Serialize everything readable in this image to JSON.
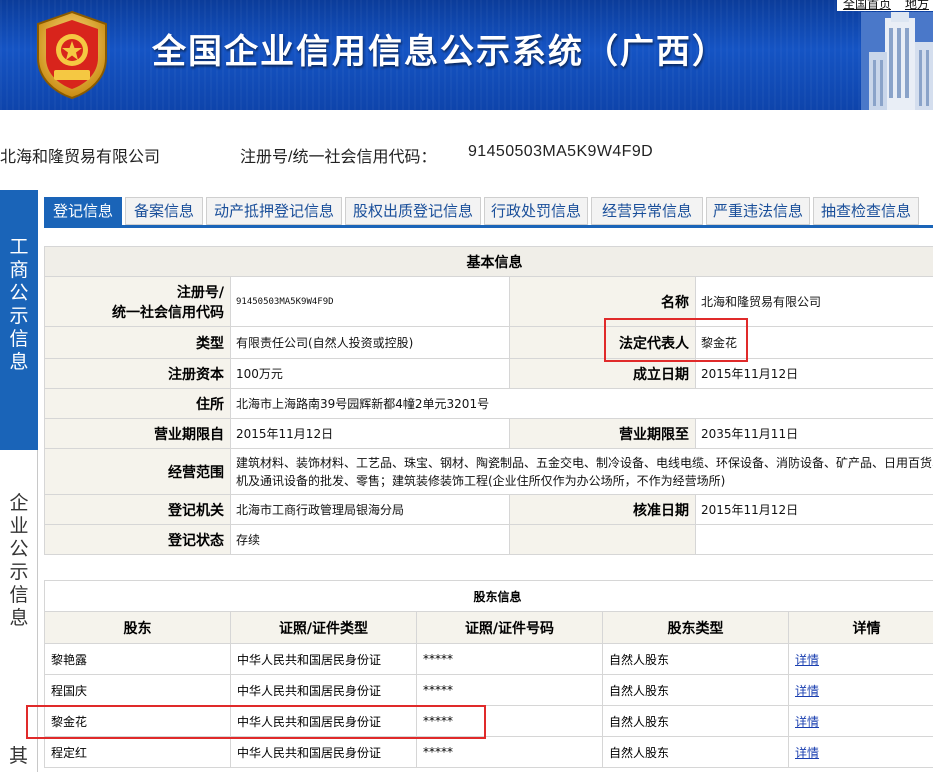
{
  "header": {
    "title": "全国企业信用信息公示系统（广西）",
    "links": [
      "全国首页",
      "地方"
    ]
  },
  "company": {
    "name": "北海和隆贸易有限公司",
    "regcode_label": "注册号/统一社会信用代码：",
    "regcode_value": "91450503MA5K9W4F9D"
  },
  "side_nav": {
    "section1": "工商公示信息",
    "section2": "企业公示信息",
    "section3": "其"
  },
  "tabs": [
    "登记信息",
    "备案信息",
    "动产抵押登记信息",
    "股权出质登记信息",
    "行政处罚信息",
    "经营异常信息",
    "严重违法信息",
    "抽查检查信息"
  ],
  "basic_info": {
    "heading": "基本信息",
    "reg_no_label_line1": "注册号/",
    "reg_no_label_line2": "统一社会信用代码",
    "reg_no": "91450503MA5K9W4F9D",
    "name_label": "名称",
    "name": "北海和隆贸易有限公司",
    "type_label": "类型",
    "type": "有限责任公司(自然人投资或控股)",
    "legal_rep_label": "法定代表人",
    "legal_rep": "黎金花",
    "capital_label": "注册资本",
    "capital": "100万元",
    "established_label": "成立日期",
    "established": "2015年11月12日",
    "address_label": "住所",
    "address": "北海市上海路南39号园辉新都4幢2单元3201号",
    "term_from_label": "营业期限自",
    "term_from": "2015年11月12日",
    "term_to_label": "营业期限至",
    "term_to": "2035年11月11日",
    "scope_label": "经营范围",
    "scope": "建筑材料、装饰材料、工艺品、珠宝、钢材、陶瓷制品、五金交电、制冷设备、电线电缆、环保设备、消防设备、矿产品、日用百货、机及通讯设备的批发、零售；建筑装修装饰工程(企业住所仅作为办公场所，不作为经营场所)",
    "authority_label": "登记机关",
    "authority": "北海市工商行政管理局银海分局",
    "approved_label": "核准日期",
    "approved": "2015年11月12日",
    "status_label": "登记状态",
    "status": "存续"
  },
  "shareholders": {
    "heading": "股东信息",
    "columns": [
      "股东",
      "证照/证件类型",
      "证照/证件号码",
      "股东类型",
      "详情"
    ],
    "rows": [
      {
        "name": "黎艳露",
        "id_type": "中华人民共和国居民身份证",
        "id_no": "*****",
        "holder_type": "自然人股东",
        "detail": "详情"
      },
      {
        "name": "程国庆",
        "id_type": "中华人民共和国居民身份证",
        "id_no": "*****",
        "holder_type": "自然人股东",
        "detail": "详情"
      },
      {
        "name": "黎金花",
        "id_type": "中华人民共和国居民身份证",
        "id_no": "*****",
        "holder_type": "自然人股东",
        "detail": "详情"
      },
      {
        "name": "程定红",
        "id_type": "中华人民共和国居民身份证",
        "id_no": "*****",
        "holder_type": "自然人股东",
        "detail": "详情"
      }
    ]
  },
  "colors": {
    "banner": "#1554c4",
    "accent": "#1a64b8",
    "label_bg": "#f5f3ec",
    "highlight": "#e02a2a",
    "link": "#1a3fb0"
  }
}
